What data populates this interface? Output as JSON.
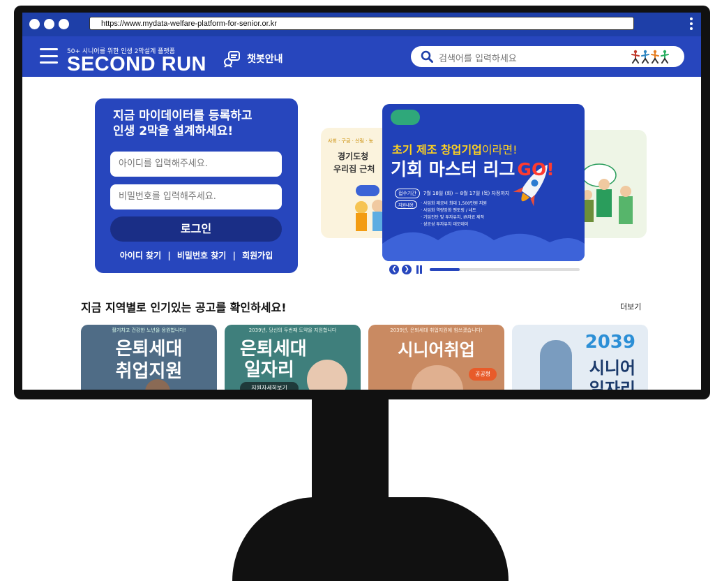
{
  "browser": {
    "url": "https://www.mydata-welfare-platform-for-senior.or.kr"
  },
  "header": {
    "tagline": "50+ 시니어를 위한 인생 2막설계 플랫폼",
    "brand": "SECOND RUN",
    "chatbot_label": "챗봇안내",
    "search_placeholder": "검색어를 입력하세요"
  },
  "login": {
    "heading_line1": "지금 마이데이터를 등록하고",
    "heading_line2": "인생 2막을 설계하세요!",
    "id_placeholder": "아이디를 입력해주세요.",
    "pw_placeholder": "비밀번호를 입력해주세요.",
    "button": "로그인",
    "find_id": "아이디 찾기",
    "find_pw": "비밀번호 찾기",
    "signup": "회원가입",
    "sep": "|"
  },
  "carousel": {
    "main": {
      "line1": "초기 제조 창업기업",
      "line1_suffix": "이라면!",
      "line2": "기회 마스터 리그",
      "go": "GO!",
      "period_label": "접수기간",
      "period": "7월 18일 (화) ~ 8월 17일 (목) 자정까지",
      "support_label": "지원내용",
      "bullets": [
        "· 사업화 제공비 최대 1,500만원 지원",
        "· 사업화 역량강화 멘토링 / 네트",
        "· 기업진단 및 투자유치, IR자료 제작",
        "· 성공성 투자유치 데모데이"
      ]
    },
    "left": {
      "tags": "사회 · 구금 · 산림 · 농",
      "line1": "경기도청 ",
      "line2": "우리집 근처"
    },
    "progress": 0.2
  },
  "section": {
    "title": "지금 지역별로 인기있는 공고를 확인하세요!",
    "more": "더보기"
  },
  "tiles": [
    {
      "top": "활기차고 건강한 노년을 응원합니다!",
      "line1": "은퇴세대",
      "line2": "취업지원"
    },
    {
      "top": "2039년, 당신의 두번째 도약을 지원합니다",
      "line1": "은퇴세대",
      "line2": "일자리",
      "button": "지원자세히보기"
    },
    {
      "top": "2039년, 은퇴세대 취업지원에 힘쓰겠습니다!",
      "line1": "시니어취업",
      "badge": "공공형"
    },
    {
      "line1": "2039",
      "line2": "시니어",
      "line3": "일자리"
    }
  ]
}
